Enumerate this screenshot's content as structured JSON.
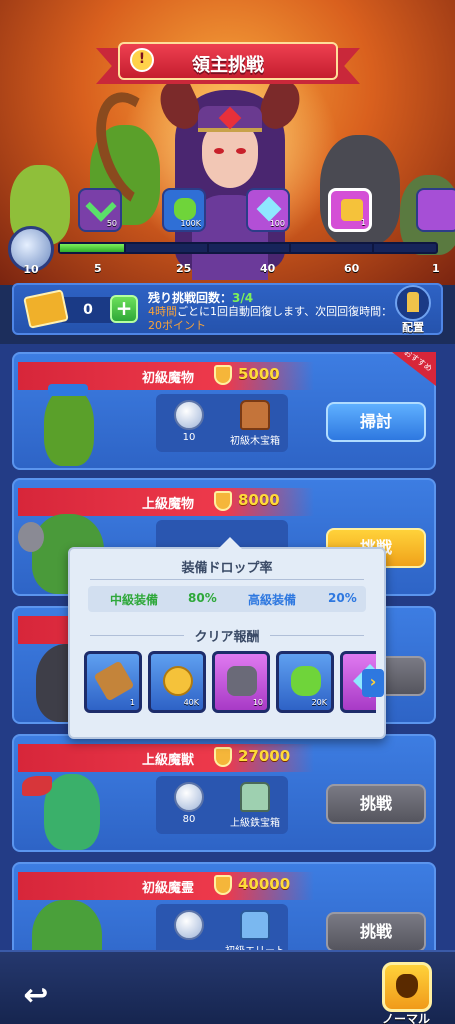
{
  "header": {
    "title": "領主挑戦",
    "info_icon": "info-icon"
  },
  "milestones": {
    "current": "10",
    "ticks": [
      "5",
      "25",
      "40",
      "60",
      "1"
    ],
    "rewards": [
      {
        "icon": "check-icon",
        "label": "50"
      },
      {
        "icon": "green-ore-icon",
        "label": "100K"
      },
      {
        "icon": "crystal-icon",
        "label": "100"
      },
      {
        "icon": "golden-key-icon",
        "label": "1"
      }
    ],
    "progress_percent": 17
  },
  "info_bar": {
    "ticket_count": "0",
    "plus_label": "+",
    "remain_label": "残り挑戦回数：",
    "remain_value": "3/4",
    "recover_hl1": "4時間",
    "recover_text": "ごとに1回自動回復します、次回回復時間：",
    "recover_hl2": "20ポイント",
    "place_label": "配置"
  },
  "cards": [
    {
      "name": "初級魔物",
      "power": "5000",
      "reward1": "10",
      "reward2": "初級木宝箱",
      "button": "掃討",
      "badge": "おすすめ"
    },
    {
      "name": "上級魔物",
      "power": "8000",
      "button": "挑戦"
    },
    {
      "name": "",
      "power": "",
      "button": "戦"
    },
    {
      "name": "上級魔獣",
      "power": "27000",
      "reward1": "80",
      "reward2": "上級鉄宝箱",
      "button": "挑戦"
    },
    {
      "name": "初級魔霊",
      "power": "40000",
      "reward1": "",
      "reward2": "初級エリート",
      "button": "挑戦"
    }
  ],
  "popup": {
    "title": "装備ドロップ率",
    "mid_label": "中級装備",
    "mid_value": "80%",
    "high_label": "高級装備",
    "high_value": "20%",
    "clear_title": "クリア報酬",
    "items": [
      {
        "icon": "hammer-icon",
        "label": "1"
      },
      {
        "icon": "gold-coin-icon",
        "label": "40K"
      },
      {
        "icon": "stone-icon",
        "label": "10"
      },
      {
        "icon": "green-ore-icon",
        "label": "20K"
      },
      {
        "icon": "crystal-icon",
        "label": ""
      }
    ],
    "next_arrow": "›"
  },
  "bottom": {
    "back_label": "↩",
    "normal_label": "ノーマル"
  },
  "colors": {
    "accent_red": "#d7263a",
    "card_blue": "#3d7de2",
    "progress_green": "#7cf05a",
    "gold": "#ffd23a"
  }
}
